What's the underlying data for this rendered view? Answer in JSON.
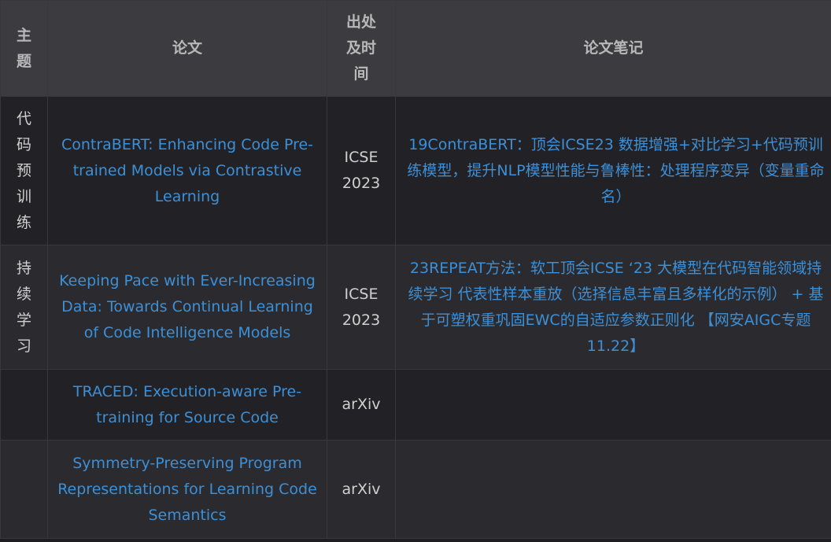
{
  "table": {
    "headers": {
      "topic": "主题",
      "paper": "论文",
      "venue": "出处及时间",
      "notes": "论文笔记"
    },
    "rows": [
      {
        "topic": "代码预训练",
        "paper": "ContraBERT: Enhancing Code Pre-trained Models via Contrastive Learning",
        "venue": "ICSE 2023",
        "note": "19ContraBERT：顶会ICSE23 数据增强+对比学习+代码预训练模型，提升NLP模型性能与鲁棒性：处理程序变异（变量重命名）"
      },
      {
        "topic": "持续学习",
        "paper": "Keeping Pace with Ever-Increasing Data: Towards Continual Learning of Code Intelligence Models",
        "venue": "ICSE 2023",
        "note": "23REPEAT方法：软工顶会ICSE ‘23 大模型在代码智能领域持续学习 代表性样本重放（选择信息丰富且多样化的示例） + 基于可塑权重巩固EWC的自适应参数正则化 【网安AIGC专题11.22】"
      },
      {
        "topic": "",
        "paper": "TRACED: Execution-aware Pre-training for Source Code",
        "venue": "arXiv",
        "note": ""
      },
      {
        "topic": "",
        "paper": "Symmetry-Preserving Program Representations for Learning Code Semantics",
        "venue": "arXiv",
        "note": ""
      }
    ]
  },
  "colors": {
    "link": "#3d8fd6",
    "header_bg": "#3c3c40",
    "row_dark": "#222226",
    "row_light": "#2b2b2f"
  }
}
